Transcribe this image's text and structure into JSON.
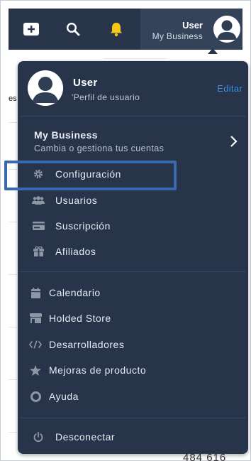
{
  "topbar": {
    "icons": [
      "add-icon",
      "search-icon",
      "bell-icon"
    ],
    "user_name": "User",
    "business_name": "My Business"
  },
  "background": {
    "fragment_left": "es",
    "bottom_number": "484 616"
  },
  "menu": {
    "profile": {
      "name": "User",
      "subtitle": "'Perfil de usuario",
      "edit_label": "Editar"
    },
    "business": {
      "title": "My Business",
      "subtitle": "Cambia o gestiona tus cuentas"
    },
    "business_items": [
      {
        "label": "Configuración",
        "icon": "gear-icon"
      },
      {
        "label": "Usuarios",
        "icon": "users-icon"
      },
      {
        "label": "Suscripción",
        "icon": "credit-card-icon"
      },
      {
        "label": "Afiliados",
        "icon": "gift-icon"
      }
    ],
    "general_items": [
      {
        "label": "Calendario",
        "icon": "calendar-icon"
      },
      {
        "label": "Holded Store",
        "icon": "store-icon"
      },
      {
        "label": "Desarrolladores",
        "icon": "code-icon"
      },
      {
        "label": "Mejoras de producto",
        "icon": "star-icon"
      },
      {
        "label": "Ayuda",
        "icon": "help-icon"
      }
    ],
    "logout_label": "Desconectar"
  },
  "colors": {
    "menu_bg": "#27344a",
    "accent_link": "#3b8edb",
    "bell": "#f5c518",
    "highlight_box": "#3b69b0"
  }
}
